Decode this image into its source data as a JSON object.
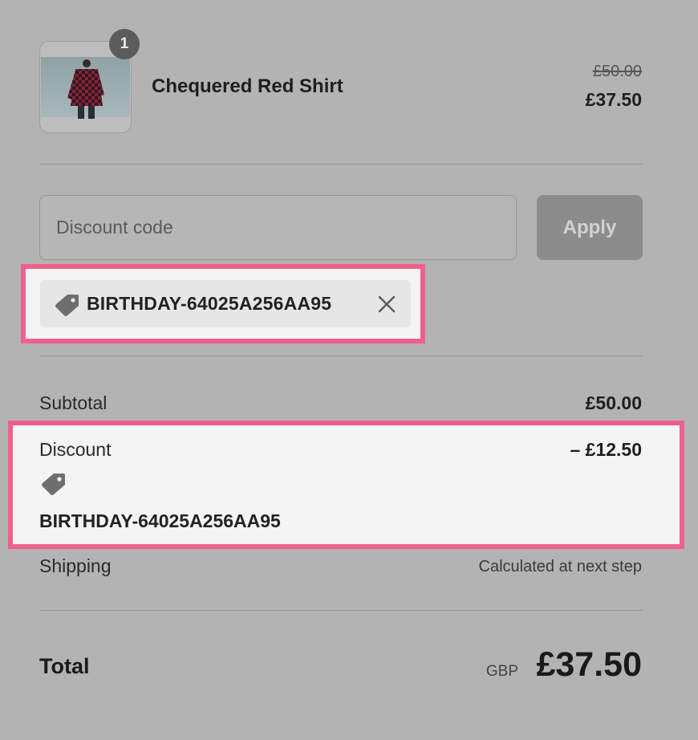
{
  "product": {
    "name": "Chequered Red Shirt",
    "quantity": "1",
    "original_price": "£50.00",
    "price": "£37.50"
  },
  "discount_form": {
    "placeholder": "Discount code",
    "apply_label": "Apply"
  },
  "applied_code": {
    "code": "BIRTHDAY-64025A256AA95",
    "icon": "tag-icon",
    "remove_icon": "close-icon"
  },
  "summary": {
    "subtotal_label": "Subtotal",
    "subtotal_value": "£50.00",
    "discount_label": "Discount",
    "discount_value": "– £12.50",
    "discount_code": "BIRTHDAY-64025A256AA95",
    "shipping_label": "Shipping",
    "shipping_value": "Calculated at next step",
    "total_label": "Total",
    "currency": "GBP",
    "total_value": "£37.50"
  },
  "colors": {
    "highlight": "#f0608d",
    "overlay": "#b3b3b3",
    "badge": "#5c5c5c"
  }
}
